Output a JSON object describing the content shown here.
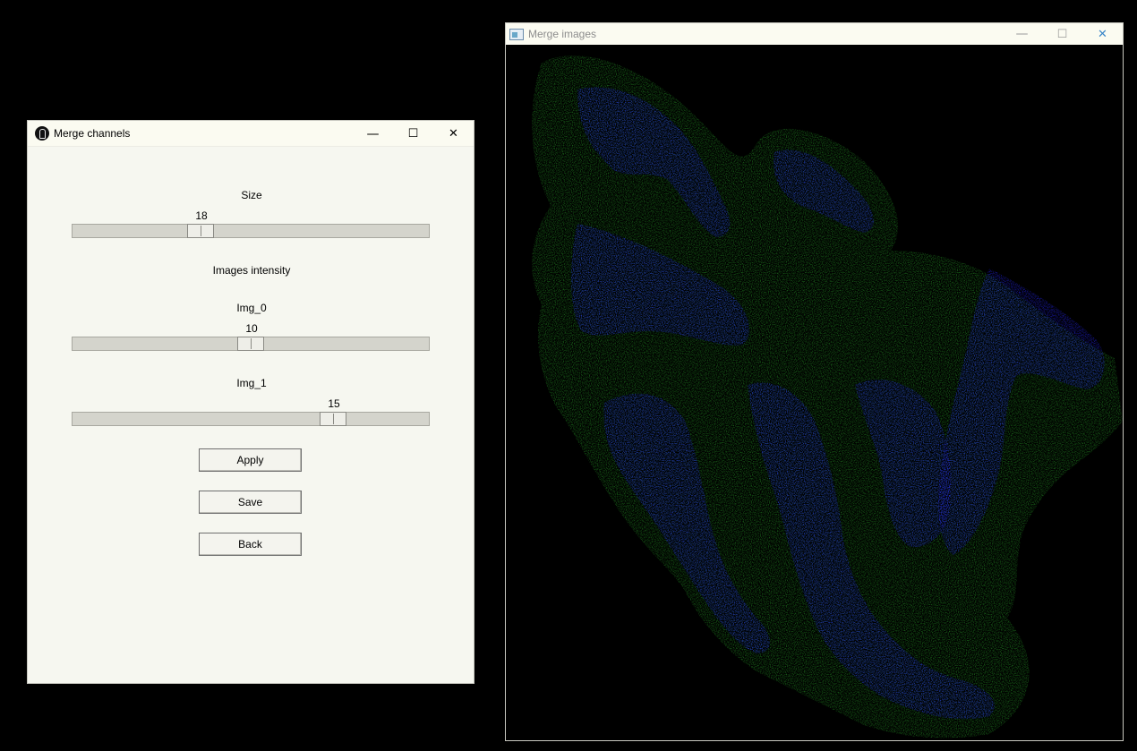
{
  "left_window": {
    "title": "Merge channels",
    "controls": {
      "minimize": "—",
      "maximize": "☐",
      "close": "✕"
    },
    "size_label": "Size",
    "size_slider": {
      "value": "18",
      "fraction": 0.37
    },
    "intensity_label": "Images intensity",
    "img0": {
      "label": "Img_0",
      "value": "10",
      "fraction": 0.5
    },
    "img1": {
      "label": "Img_1",
      "value": "15",
      "fraction": 0.73
    },
    "buttons": {
      "apply": "Apply",
      "save": "Save",
      "back": "Back"
    }
  },
  "right_window": {
    "title": "Merge images",
    "controls": {
      "minimize": "—",
      "maximize": "☐",
      "close": "✕"
    },
    "image_colors": {
      "nuclei": "#1f1fd6",
      "tissue": "#1f7a1f",
      "background": "#000000"
    }
  }
}
